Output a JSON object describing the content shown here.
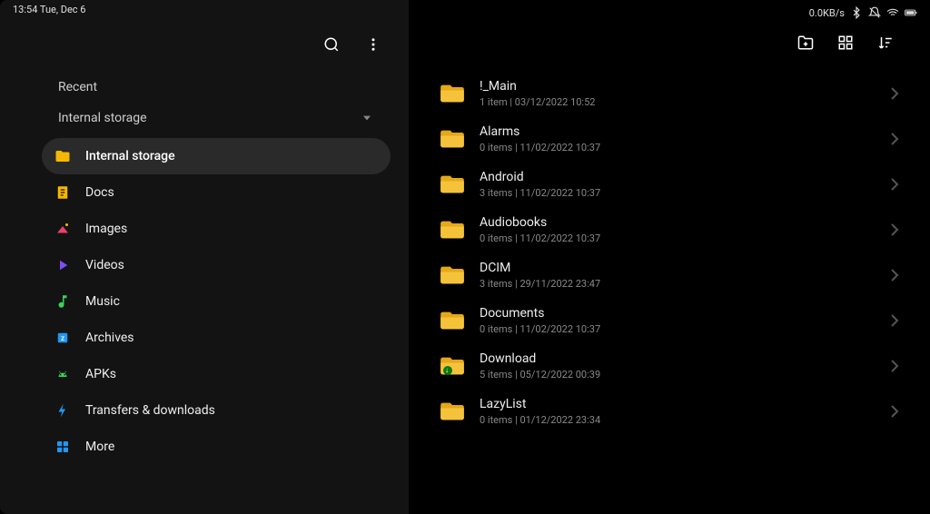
{
  "statusbar": {
    "time_date": "13:54  Tue, Dec 6",
    "network_speed": "0.0KB/s"
  },
  "sidebar": {
    "recent_label": "Recent",
    "storage_dropdown": "Internal storage",
    "items": [
      {
        "label": "Internal storage",
        "icon": "folder",
        "active": true
      },
      {
        "label": "Docs",
        "icon": "docs"
      },
      {
        "label": "Images",
        "icon": "images"
      },
      {
        "label": "Videos",
        "icon": "videos"
      },
      {
        "label": "Music",
        "icon": "music"
      },
      {
        "label": "Archives",
        "icon": "archives"
      },
      {
        "label": "APKs",
        "icon": "apks"
      },
      {
        "label": "Transfers & downloads",
        "icon": "transfers"
      },
      {
        "label": "More",
        "icon": "more"
      }
    ]
  },
  "folders": [
    {
      "name": "!_Main",
      "count": "1 item",
      "date": "03/12/2022 10:52",
      "badge": false
    },
    {
      "name": "Alarms",
      "count": "0 items",
      "date": "11/02/2022 10:37",
      "badge": false
    },
    {
      "name": "Android",
      "count": "3 items",
      "date": "11/02/2022 10:37",
      "badge": false
    },
    {
      "name": "Audiobooks",
      "count": "0 items",
      "date": "11/02/2022 10:37",
      "badge": false
    },
    {
      "name": "DCIM",
      "count": "3 items",
      "date": "29/11/2022 23:47",
      "badge": false
    },
    {
      "name": "Documents",
      "count": "0 items",
      "date": "11/02/2022 10:37",
      "badge": false
    },
    {
      "name": "Download",
      "count": "5 items",
      "date": "05/12/2022 00:39",
      "badge": true
    },
    {
      "name": "LazyList",
      "count": "0 items",
      "date": "01/12/2022 23:34",
      "badge": false
    }
  ]
}
